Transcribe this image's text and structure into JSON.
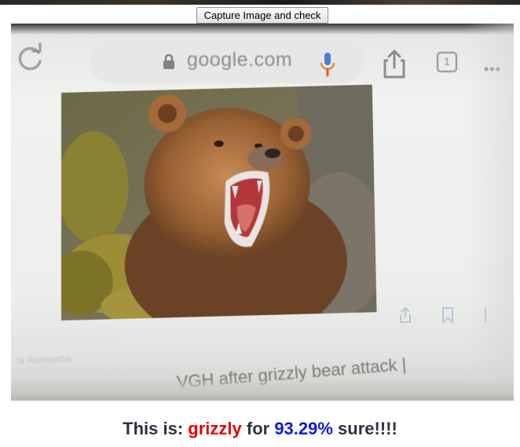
{
  "button": {
    "label": "Capture Image and check"
  },
  "camera": {
    "browser": {
      "url": "google.com",
      "tab_count": "1",
      "more": "•••"
    },
    "icons": [
      "refresh-icon",
      "lock-icon",
      "mic-icon",
      "share-icon",
      "tabs-icon",
      "more-icon"
    ],
    "chip_text": "is Awesome",
    "caption": "VGH after grizzly bear attack |"
  },
  "result": {
    "prefix": "This is: ",
    "label": "grizzly",
    "middle": " for ",
    "percent": "93.29%",
    "suffix": " sure!!!!"
  },
  "colors": {
    "label": "#e3000b",
    "percent": "#1018e6",
    "text": "#2d3340"
  }
}
